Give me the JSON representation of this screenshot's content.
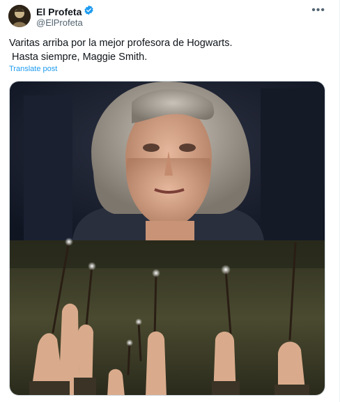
{
  "author": {
    "name": "El Profeta",
    "handle": "@ElProfeta",
    "avatar_icon": "profile-avatar",
    "verified_icon": "verified-badge-icon",
    "verified_color": "#1d9bf0"
  },
  "more_icon": "more-options-icon",
  "tweet": {
    "line1": "Varitas arriba por la mejor profesora de Hogwarts.",
    "line2": " Hasta siempre, Maggie Smith."
  },
  "translate_label": "Translate post",
  "media": {
    "top_image": "portrait-photo",
    "bottom_image": "raised-wands-photo"
  }
}
